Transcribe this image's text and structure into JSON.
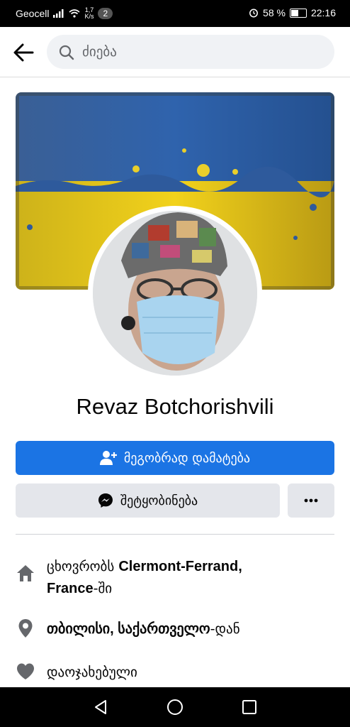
{
  "status_bar": {
    "carrier": "Geocell",
    "speed_value": "1,7",
    "speed_unit": "K/s",
    "notification_count": "2",
    "battery_percent": "58 %",
    "battery_level": 0.58,
    "time": "22:16"
  },
  "header": {
    "search_placeholder": "ძიება"
  },
  "profile": {
    "name": "Revaz Botchorishvili"
  },
  "actions": {
    "add_friend_label": "მეგობრად დამატება",
    "message_label": "შეტყობინება",
    "more_label": "•••"
  },
  "about": {
    "lives_prefix": "ცხოვრობს ",
    "lives_city": "Clermont-Ferrand,",
    "lives_country": "France",
    "lives_suffix": "-ში",
    "from_place": "თბილისი, საქართველო",
    "from_suffix": "-დან",
    "relationship": "დაოჯახებული"
  },
  "colors": {
    "primary": "#1b74e4",
    "secondary_button": "#e4e6eb",
    "icon_gray": "#65676b",
    "flag_blue": "#2f5fa8",
    "flag_yellow": "#f2d21b"
  },
  "icons": {
    "back": "arrow-left-icon",
    "search": "magnifier-icon",
    "add_friend": "person-plus-icon",
    "message": "messenger-icon",
    "more": "ellipsis-icon",
    "home": "house-icon",
    "location": "pin-icon",
    "relationship": "heart-icon",
    "nav_back": "triangle-back-icon",
    "nav_home": "circle-home-icon",
    "nav_recent": "square-recent-icon"
  }
}
